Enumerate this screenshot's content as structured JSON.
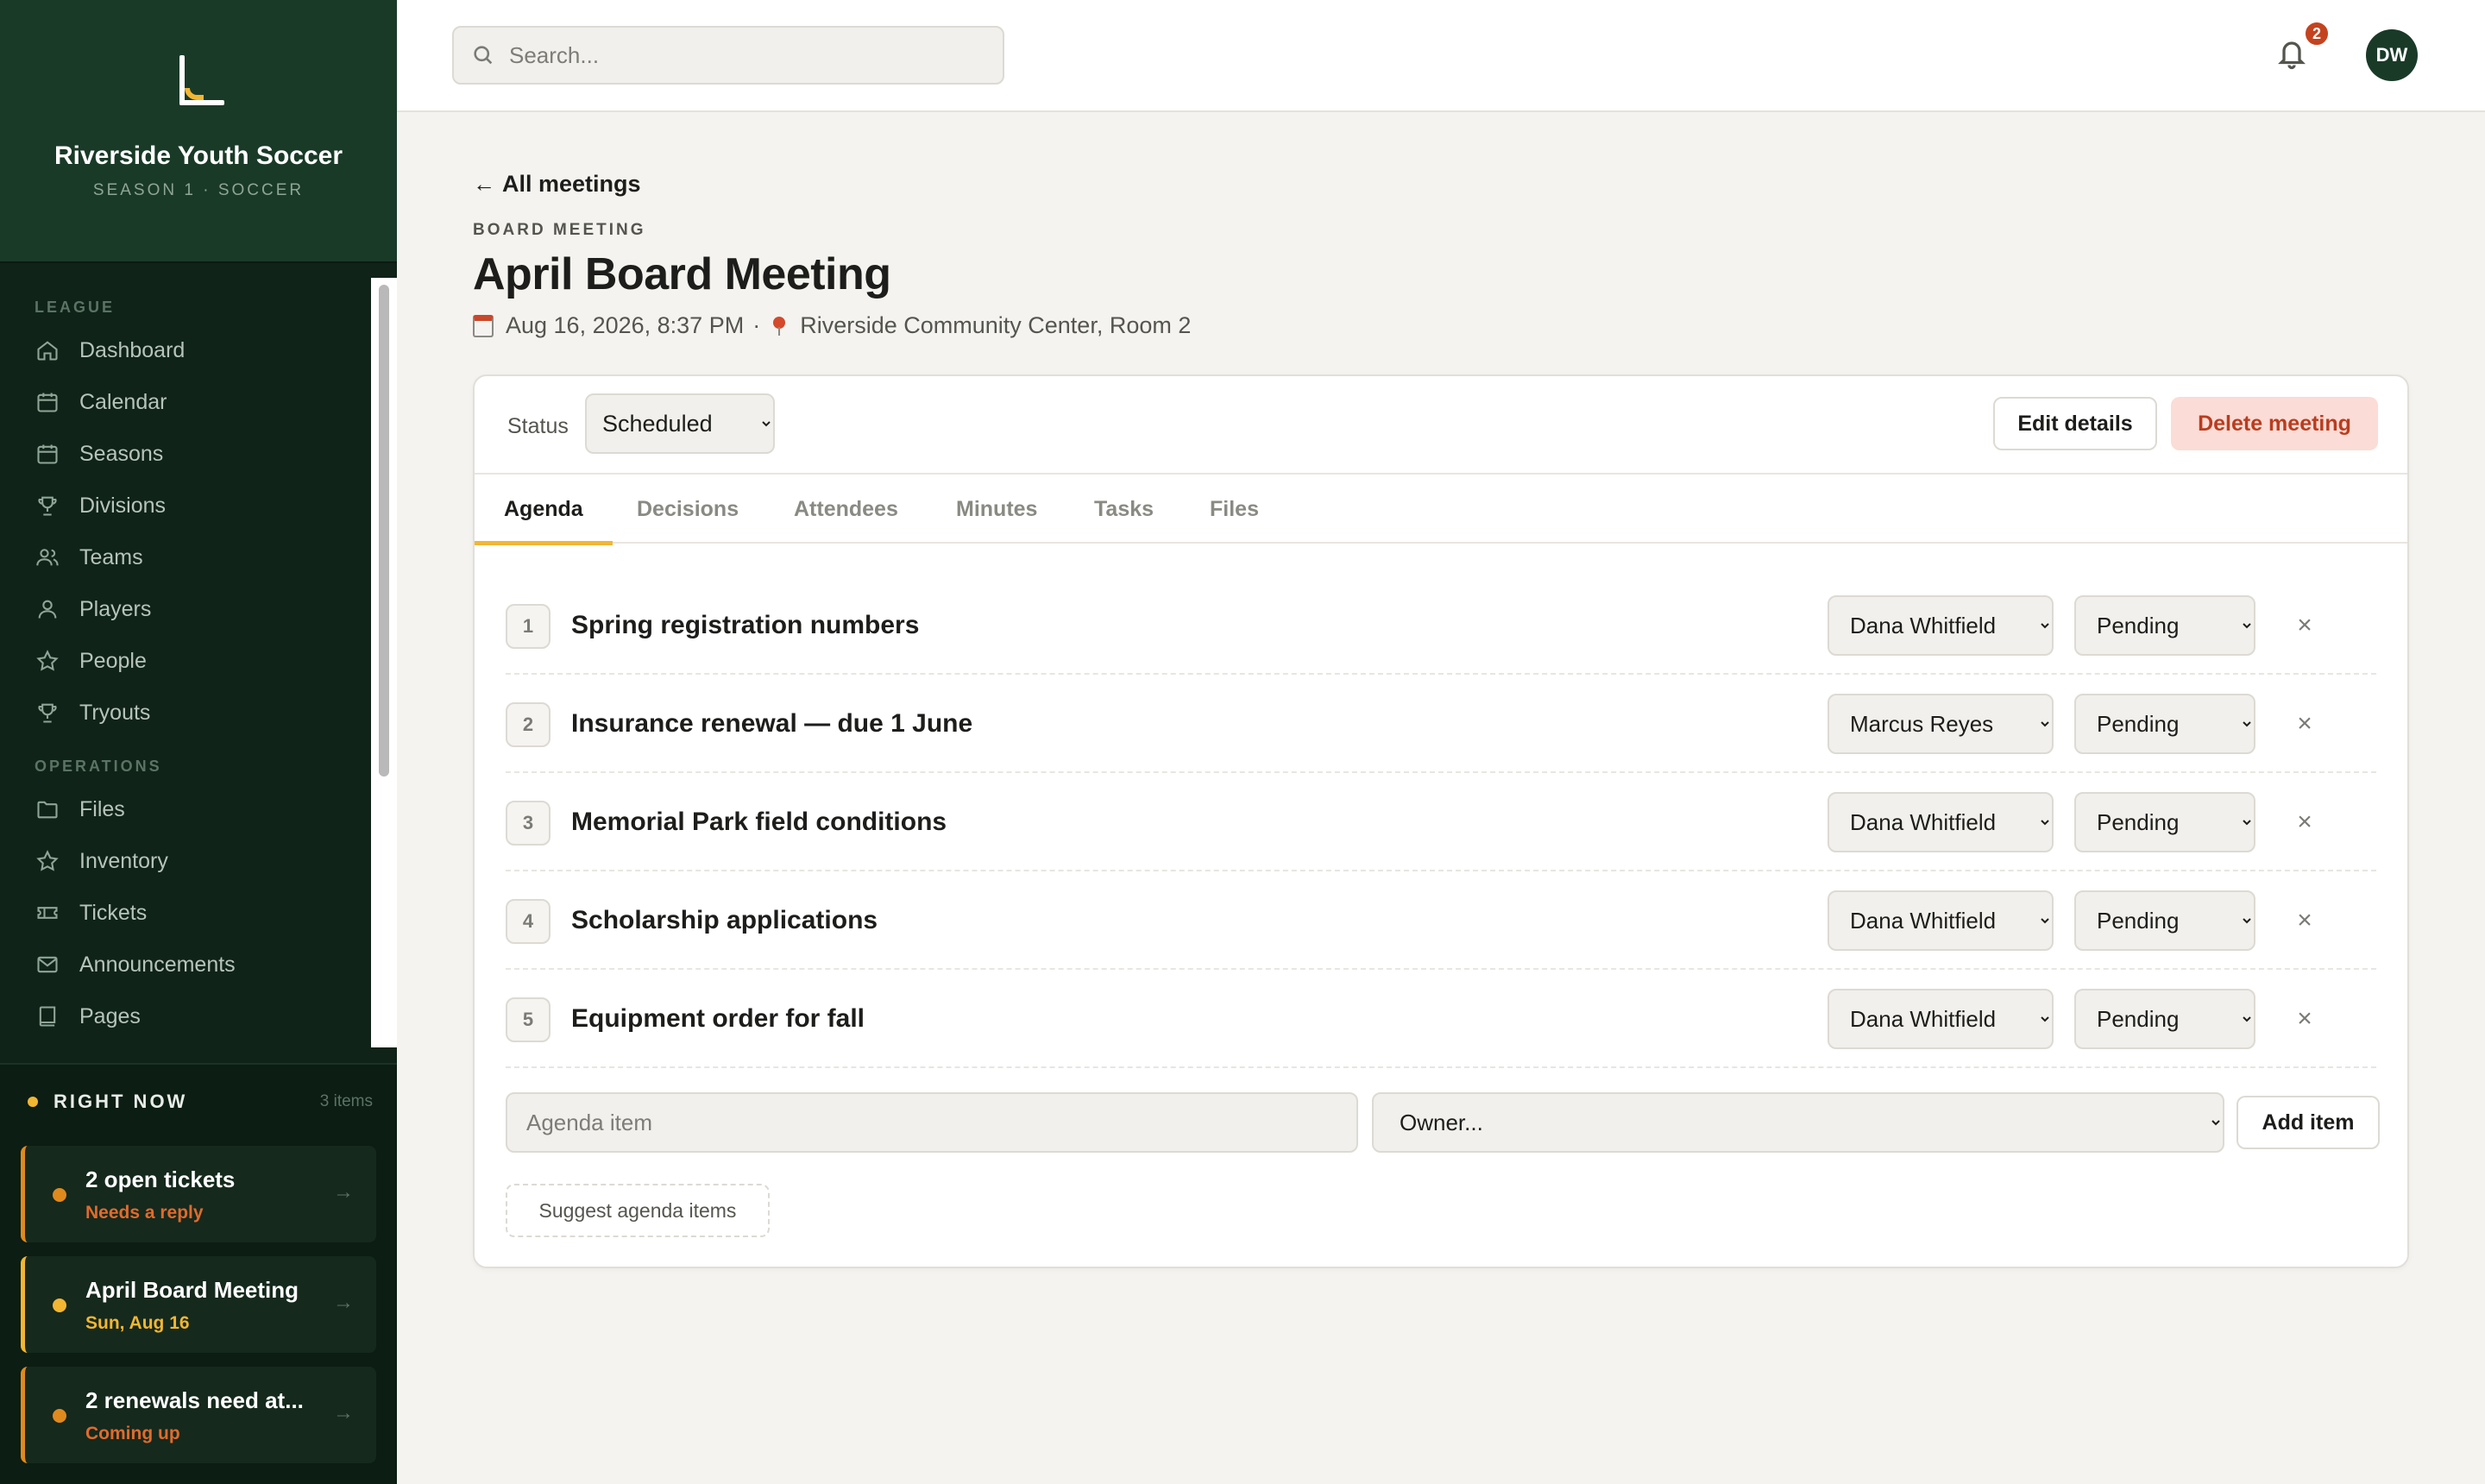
{
  "brand": {
    "name": "Riverside Youth Soccer",
    "subtitle": "SEASON 1 · SOCCER"
  },
  "sidebar": {
    "sections": [
      {
        "label": "LEAGUE",
        "items": [
          {
            "label": "Dashboard",
            "icon": "home-icon"
          },
          {
            "label": "Calendar",
            "icon": "calendar-icon"
          },
          {
            "label": "Seasons",
            "icon": "calendar-icon"
          },
          {
            "label": "Divisions",
            "icon": "trophy-icon"
          },
          {
            "label": "Teams",
            "icon": "users-icon"
          },
          {
            "label": "Players",
            "icon": "user-icon"
          },
          {
            "label": "People",
            "icon": "star-icon"
          },
          {
            "label": "Tryouts",
            "icon": "trophy-icon"
          }
        ]
      },
      {
        "label": "OPERATIONS",
        "items": [
          {
            "label": "Files",
            "icon": "folder-icon"
          },
          {
            "label": "Inventory",
            "icon": "star-icon"
          },
          {
            "label": "Tickets",
            "icon": "ticket-icon"
          },
          {
            "label": "Announcements",
            "icon": "mail-icon"
          },
          {
            "label": "Pages",
            "icon": "book-icon"
          }
        ]
      }
    ]
  },
  "right_now": {
    "title": "RIGHT NOW",
    "count": "3 items",
    "cards": [
      {
        "title": "2 open tickets",
        "subtitle": "Needs a reply",
        "accent": "#e08a1e"
      },
      {
        "title": "April Board Meeting",
        "subtitle": "Sun, Aug 16",
        "accent": "#f2b632"
      },
      {
        "title": "2 renewals need at...",
        "subtitle": "Coming up",
        "accent": "#e08a1e"
      }
    ]
  },
  "topbar": {
    "search_placeholder": "Search...",
    "notifications": "2",
    "avatar_initials": "DW"
  },
  "page": {
    "back_label": "All meetings",
    "eyebrow": "BOARD MEETING",
    "title": "April Board Meeting",
    "datetime": "Aug 16, 2026, 8:37 PM",
    "separator": "·",
    "location": "Riverside Community Center, Room 2"
  },
  "panel": {
    "status_label": "Status",
    "status_value": "Scheduled",
    "edit_label": "Edit details",
    "delete_label": "Delete meeting",
    "tabs": [
      "Agenda",
      "Decisions",
      "Attendees",
      "Minutes",
      "Tasks",
      "Files"
    ],
    "active_tab": "Agenda"
  },
  "agenda": [
    {
      "number": "1",
      "title": "Spring registration numbers",
      "owner": "Dana Whitfield",
      "status": "Pending"
    },
    {
      "number": "2",
      "title": "Insurance renewal — due 1 June",
      "owner": "Marcus Reyes",
      "status": "Pending"
    },
    {
      "number": "3",
      "title": "Memorial Park field conditions",
      "owner": "Dana Whitfield",
      "status": "Pending"
    },
    {
      "number": "4",
      "title": "Scholarship applications",
      "owner": "Dana Whitfield",
      "status": "Pending"
    },
    {
      "number": "5",
      "title": "Equipment order for fall",
      "owner": "Dana Whitfield",
      "status": "Pending"
    }
  ],
  "add_form": {
    "item_placeholder": "Agenda item",
    "owner_placeholder": "Owner...",
    "add_label": "Add item",
    "suggest_label": "Suggest agenda items",
    "remove_glyph": "×"
  },
  "colors": {
    "sidebar_bg": "#0f2318",
    "brand_bg": "#1a3a28",
    "accent": "#f2b632",
    "danger": "#b93d1f",
    "warning": "#e08a1e"
  }
}
